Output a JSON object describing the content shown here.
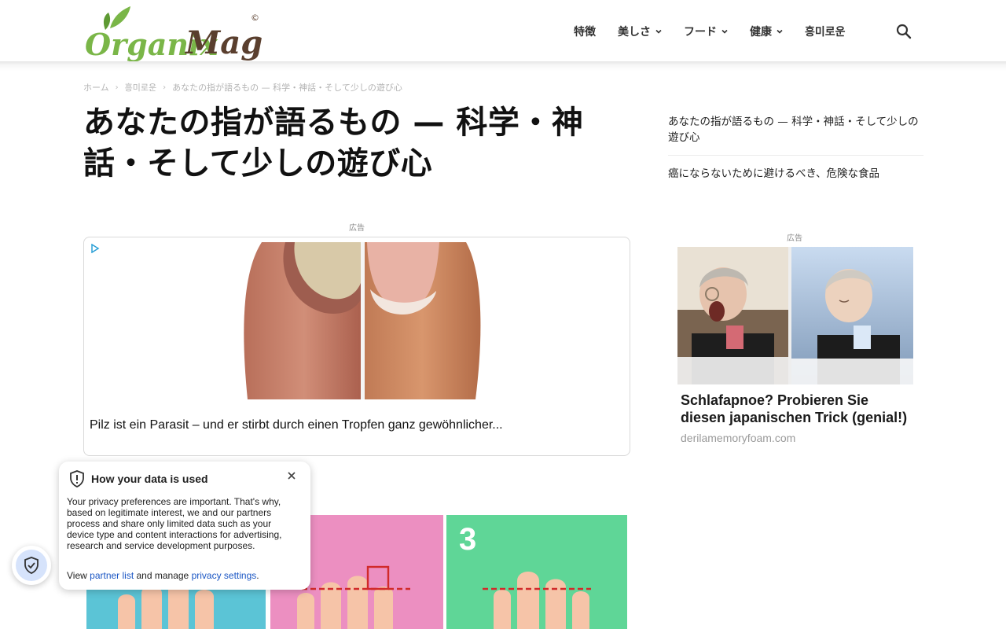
{
  "header": {
    "nav": [
      {
        "label": "特徴",
        "has_dropdown": false
      },
      {
        "label": "美しさ",
        "has_dropdown": true
      },
      {
        "label": "フード",
        "has_dropdown": true
      },
      {
        "label": "健康",
        "has_dropdown": true
      },
      {
        "label": "흥미로운",
        "has_dropdown": false
      }
    ],
    "search_icon": "search-icon"
  },
  "logo": {
    "text_organix": "Organix",
    "text_mag": "Mag",
    "copyright": "©",
    "colors": {
      "green": "#7ab648",
      "brown": "#5a3f2e"
    }
  },
  "breadcrumb": {
    "home": "ホーム",
    "category": "흥미로운",
    "current": "あなたの指が語るもの — 科学・神話・そして少しの遊び心"
  },
  "article": {
    "title": "あなたの指が語るもの — 科学・神話・そして少しの遊び心"
  },
  "main_ad": {
    "label": "広告",
    "text": "Pilz ist ein Parasit – und er stirbt durch einen Tropfen ganz gewöhnlicher..."
  },
  "fingers_image": {
    "panel_number": "3",
    "colors": [
      "#5bc4d6",
      "#ec8fc1",
      "#5fd697"
    ],
    "line_color": "#d12a2a"
  },
  "sidebar": {
    "links": [
      "あなたの指が語るもの — 科学・神話・そして少しの遊び心",
      "癌にならないために避けるべき、危険な食品"
    ],
    "ad": {
      "label": "広告",
      "title": "Schlafapnoe? Probieren Sie diesen japanischen Trick (genial!)",
      "domain": "derilamemoryfoam.com"
    }
  },
  "privacy_popup": {
    "title": "How your data is used",
    "body": "Your privacy preferences are important. That's why, based on legitimate interest, we and our partners process and share only limited data such as your device type and content interactions for advertising, research and service development purposes.",
    "footer_prefix": "View ",
    "partner_link": "partner list",
    "footer_middle": " and manage ",
    "settings_link": "privacy settings",
    "footer_suffix": ".",
    "close_icon": "close-icon",
    "accent": "#1a56c4"
  }
}
